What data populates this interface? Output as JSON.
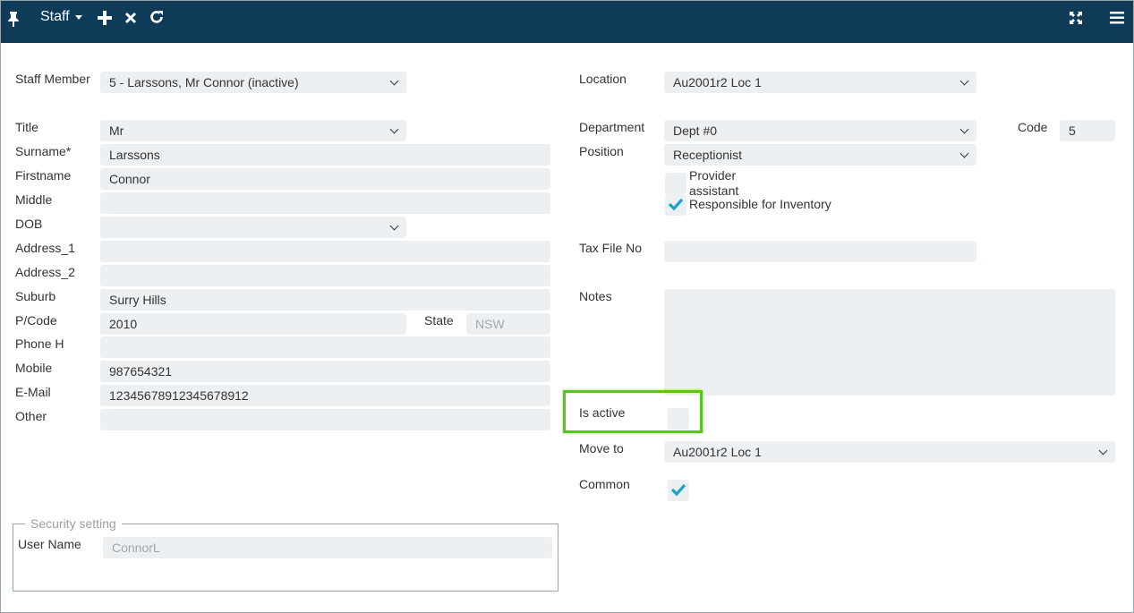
{
  "toolbar": {
    "title": "Staff",
    "pin_icon": "pin-icon",
    "add_icon": "plus-icon",
    "close_icon": "x-icon",
    "refresh_icon": "refresh-icon",
    "expand_icon": "expand-icon",
    "menu_icon": "hamburger-icon"
  },
  "left": {
    "staff_member": {
      "label": "Staff Member",
      "value": "5 - Larssons, Mr Connor (inactive)"
    },
    "title": {
      "label": "Title",
      "value": "Mr"
    },
    "surname": {
      "label": "Surname*",
      "value": "Larssons"
    },
    "firstname": {
      "label": "Firstname",
      "value": "Connor"
    },
    "middle": {
      "label": "Middle",
      "value": ""
    },
    "dob": {
      "label": "DOB",
      "value": ""
    },
    "address_1": {
      "label": "Address_1",
      "value": ""
    },
    "address_2": {
      "label": "Address_2",
      "value": ""
    },
    "suburb": {
      "label": "Suburb",
      "value": "Surry Hills"
    },
    "pcode": {
      "label": "P/Code",
      "value": "2010"
    },
    "state": {
      "label": "State",
      "value": "NSW"
    },
    "phone_h": {
      "label": "Phone H",
      "value": ""
    },
    "mobile": {
      "label": "Mobile",
      "value": "987654321"
    },
    "email": {
      "label": "E-Mail",
      "value": "12345678912345678912"
    },
    "other": {
      "label": "Other",
      "value": ""
    }
  },
  "security": {
    "legend": "Security setting",
    "user_name": {
      "label": "User Name",
      "value": "ConnorL"
    }
  },
  "right": {
    "location": {
      "label": "Location",
      "value": "Au2001r2 Loc 1"
    },
    "department": {
      "label": "Department",
      "value": "Dept #0"
    },
    "code": {
      "label": "Code",
      "value": "5"
    },
    "position": {
      "label": "Position",
      "value": "Receptionist"
    },
    "provider_assistant": {
      "label_line1": "Provider",
      "label_line2": "assistant",
      "checked": false
    },
    "responsible_inventory": {
      "label": "Responsible for Inventory",
      "checked": true
    },
    "tax_file_no": {
      "label": "Tax File No",
      "value": ""
    },
    "notes": {
      "label": "Notes",
      "value": ""
    },
    "is_active": {
      "label": "Is active",
      "checked": false
    },
    "move_to": {
      "label": "Move to",
      "value": "Au2001r2 Loc 1"
    },
    "common": {
      "label": "Common",
      "checked": true
    }
  },
  "colors": {
    "header_bg": "#0e3b58",
    "field_bg": "#edf0f3",
    "check_color": "#1aa3c9",
    "highlight": "#58c322"
  }
}
